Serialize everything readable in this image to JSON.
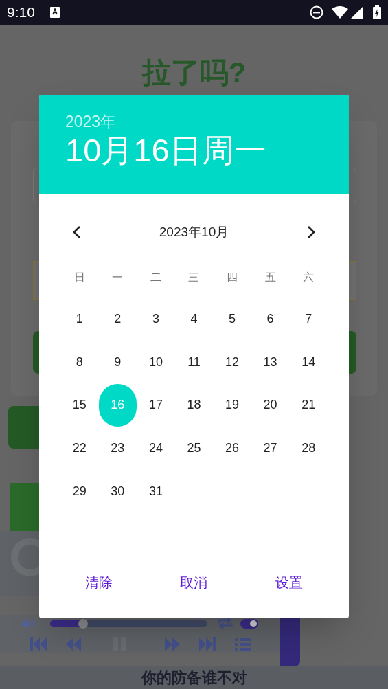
{
  "status_bar": {
    "time": "9:10"
  },
  "background": {
    "title": "拉了吗?",
    "player": {
      "level": 0.21,
      "loop_on": true
    },
    "footer": "你的防备谁不对"
  },
  "dialog": {
    "year": "2023年",
    "date": "10月16日周一",
    "month_title": "2023年10月",
    "weekdays": [
      "日",
      "一",
      "二",
      "三",
      "四",
      "五",
      "六"
    ],
    "days": [
      {
        "label": "1",
        "selected": false
      },
      {
        "label": "2",
        "selected": false
      },
      {
        "label": "3",
        "selected": false
      },
      {
        "label": "4",
        "selected": false
      },
      {
        "label": "5",
        "selected": false
      },
      {
        "label": "6",
        "selected": false
      },
      {
        "label": "7",
        "selected": false
      },
      {
        "label": "8",
        "selected": false
      },
      {
        "label": "9",
        "selected": false
      },
      {
        "label": "10",
        "selected": false
      },
      {
        "label": "11",
        "selected": false
      },
      {
        "label": "12",
        "selected": false
      },
      {
        "label": "13",
        "selected": false
      },
      {
        "label": "14",
        "selected": false
      },
      {
        "label": "15",
        "selected": false
      },
      {
        "label": "16",
        "selected": true
      },
      {
        "label": "17",
        "selected": false
      },
      {
        "label": "18",
        "selected": false
      },
      {
        "label": "19",
        "selected": false
      },
      {
        "label": "20",
        "selected": false
      },
      {
        "label": "21",
        "selected": false
      },
      {
        "label": "22",
        "selected": false
      },
      {
        "label": "23",
        "selected": false
      },
      {
        "label": "24",
        "selected": false
      },
      {
        "label": "25",
        "selected": false
      },
      {
        "label": "26",
        "selected": false
      },
      {
        "label": "27",
        "selected": false
      },
      {
        "label": "28",
        "selected": false
      },
      {
        "label": "29",
        "selected": false
      },
      {
        "label": "30",
        "selected": false
      },
      {
        "label": "31",
        "selected": false
      }
    ],
    "buttons": [
      "清除",
      "取消",
      "设置"
    ]
  }
}
